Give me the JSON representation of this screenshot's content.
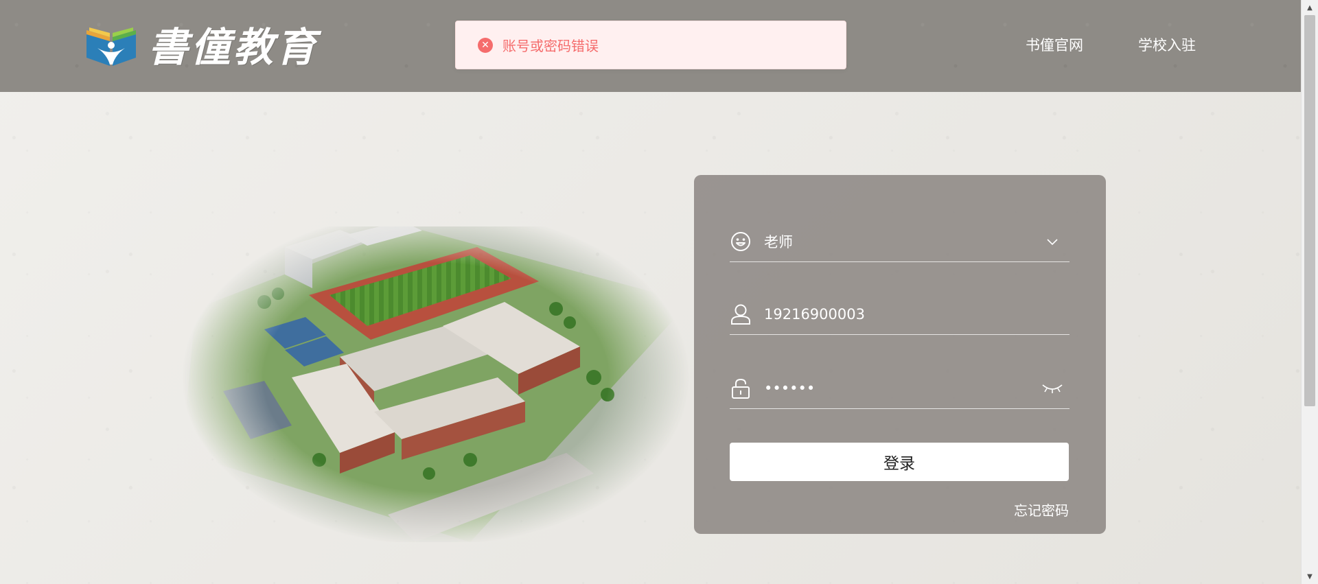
{
  "header": {
    "logo_text": "書僮教育",
    "nav": [
      "书僮官网",
      "学校入驻"
    ]
  },
  "toast": {
    "message": "账号或密码错误",
    "icon": "error-circle-icon",
    "color": "#f56c6c"
  },
  "login": {
    "role_value": "老师",
    "account_value": "19216900003",
    "password_masked": "••••••",
    "login_button": "登录",
    "forgot_password": "忘记密码"
  },
  "icons": {
    "role": "smiley-icon",
    "account": "user-icon",
    "password": "lock-icon",
    "dropdown": "chevron-down-icon",
    "visibility": "eye-closed-icon"
  }
}
